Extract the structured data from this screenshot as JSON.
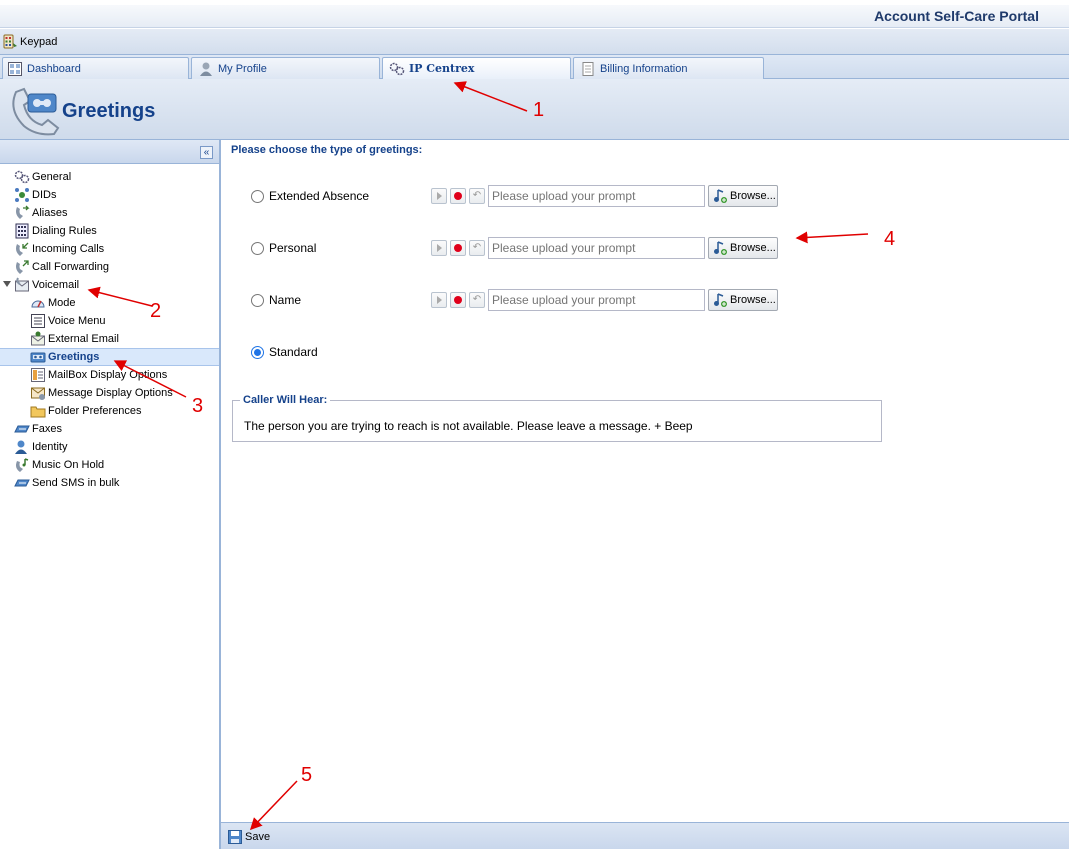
{
  "portal": {
    "title": "Account Self-Care Portal"
  },
  "toolbar": {
    "keypad_label": "Keypad"
  },
  "tabs": [
    {
      "label": "Dashboard",
      "icon": "dashboard-icon"
    },
    {
      "label": "My Profile",
      "icon": "user-icon"
    },
    {
      "label": "IP Centrex",
      "icon": "gears-icon",
      "active": true
    },
    {
      "label": "Billing Information",
      "icon": "document-icon"
    }
  ],
  "page": {
    "title": "Greetings",
    "icon": "telephone-icon"
  },
  "sidebar": {
    "collapse_label": "«",
    "items": [
      {
        "label": "General"
      },
      {
        "label": "DIDs"
      },
      {
        "label": "Aliases"
      },
      {
        "label": "Dialing Rules"
      },
      {
        "label": "Incoming Calls"
      },
      {
        "label": "Call Forwarding"
      },
      {
        "label": "Voicemail",
        "expanded": true
      },
      {
        "label": "Mode"
      },
      {
        "label": "Voice Menu"
      },
      {
        "label": "External Email"
      },
      {
        "label": "Greetings",
        "selected": true
      },
      {
        "label": "MailBox Display Options"
      },
      {
        "label": "Message Display Options"
      },
      {
        "label": "Folder Preferences"
      },
      {
        "label": "Faxes"
      },
      {
        "label": "Identity"
      },
      {
        "label": "Music On Hold"
      },
      {
        "label": "Send SMS in bulk"
      }
    ]
  },
  "main": {
    "prompt": "Please choose the type of greetings:",
    "greetings": [
      {
        "label": "Extended Absence",
        "checked": false,
        "placeholder": "Please upload your prompt",
        "browse": "Browse..."
      },
      {
        "label": "Personal",
        "checked": false,
        "placeholder": "Please upload your prompt",
        "browse": "Browse..."
      },
      {
        "label": "Name",
        "checked": false,
        "placeholder": "Please upload your prompt",
        "browse": "Browse..."
      },
      {
        "label": "Standard",
        "checked": true
      }
    ],
    "caller_hears": {
      "legend": "Caller Will Hear:",
      "text": "The person you are trying to reach is not available. Please leave a message. + Beep"
    }
  },
  "footer": {
    "save_label": "Save"
  },
  "annotations": [
    "1",
    "2",
    "3",
    "4",
    "5"
  ],
  "colors": {
    "accent": "#15428b",
    "annotation": "#e00000",
    "selected_bg": "#d9e8fb"
  }
}
